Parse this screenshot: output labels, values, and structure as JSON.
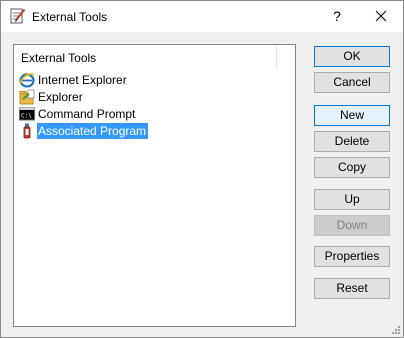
{
  "window": {
    "title": "External Tools",
    "help_label": "?"
  },
  "list": {
    "header": "External Tools",
    "items": [
      {
        "label": "Internet Explorer",
        "icon": "internet-explorer-icon",
        "selected": false
      },
      {
        "label": "Explorer",
        "icon": "explorer-icon",
        "selected": false
      },
      {
        "label": "Command Prompt",
        "icon": "command-prompt-icon",
        "selected": false
      },
      {
        "label": "Associated Program",
        "icon": "associated-program-icon",
        "selected": true
      }
    ]
  },
  "buttons": {
    "ok": "OK",
    "cancel": "Cancel",
    "new": "New",
    "delete": "Delete",
    "copy": "Copy",
    "up": "Up",
    "down": "Down",
    "properties": "Properties",
    "reset": "Reset"
  },
  "colors": {
    "selection": "#3399ff",
    "accent_border": "#0078d7",
    "button_face": "#e1e1e1",
    "dialog_bg": "#f0f0f0"
  }
}
